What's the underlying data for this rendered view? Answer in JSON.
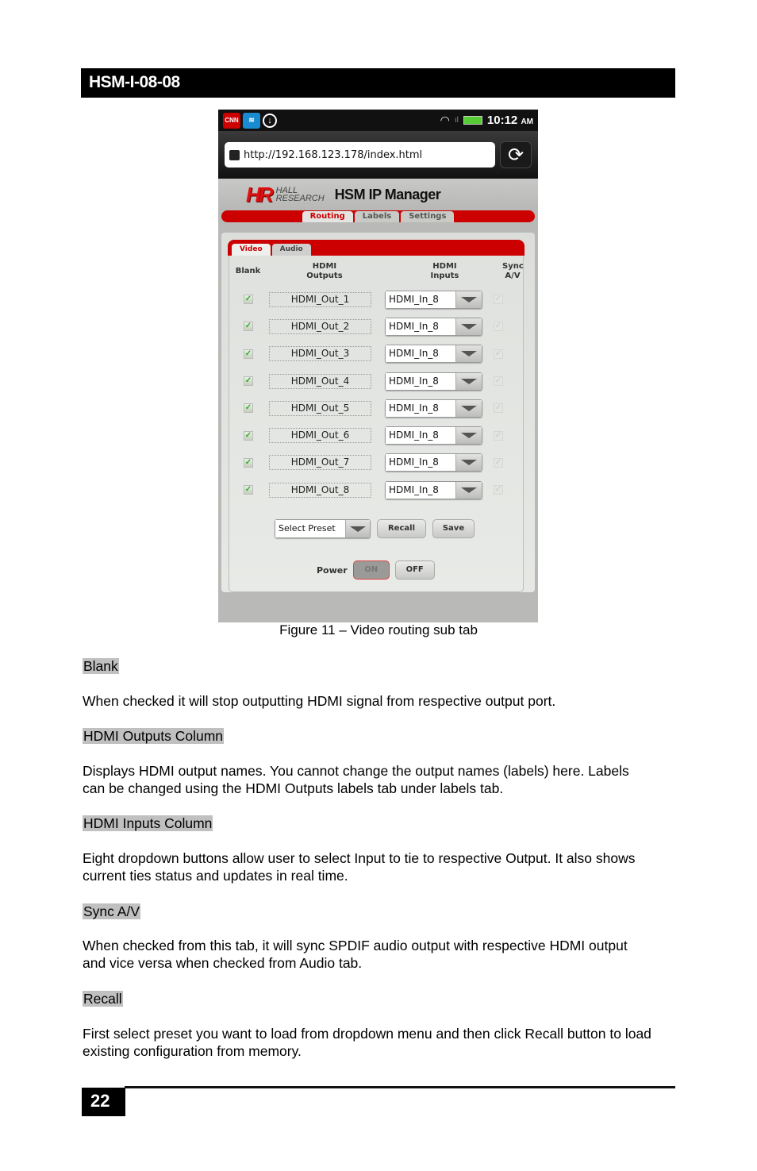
{
  "header": {
    "title": "HSM-I-08-08"
  },
  "phone": {
    "status_bar": {
      "icons": [
        "cnn-icon",
        "wireless-app-icon",
        "download-icon",
        "wifi-icon",
        "signal-icon",
        "battery-icon"
      ],
      "cnn_label": "CNN",
      "time": "10:12",
      "ampm": "AM"
    },
    "browser": {
      "url": "http://192.168.123.178/index.html"
    },
    "app": {
      "brand_logo": "HR",
      "brand_name_line1": "HALL",
      "brand_name_line2": "RESEARCH",
      "title": "HSM IP Manager",
      "main_tabs": [
        {
          "label": "Routing",
          "active": true
        },
        {
          "label": "Labels",
          "active": false
        },
        {
          "label": "Settings",
          "active": false
        }
      ],
      "sub_tabs": [
        {
          "label": "Video",
          "active": true
        },
        {
          "label": "Audio",
          "active": false
        }
      ],
      "columns": {
        "blank": "Blank",
        "outputs_l1": "HDMI",
        "outputs_l2": "Outputs",
        "inputs_l1": "HDMI",
        "inputs_l2": "Inputs",
        "sync_l1": "Sync",
        "sync_l2": "A/V"
      },
      "rows": [
        {
          "blank": true,
          "output": "HDMI_Out_1",
          "input": "HDMI_In_8",
          "sync": false
        },
        {
          "blank": true,
          "output": "HDMI_Out_2",
          "input": "HDMI_In_8",
          "sync": false
        },
        {
          "blank": true,
          "output": "HDMI_Out_3",
          "input": "HDMI_In_8",
          "sync": false
        },
        {
          "blank": true,
          "output": "HDMI_Out_4",
          "input": "HDMI_In_8",
          "sync": false
        },
        {
          "blank": true,
          "output": "HDMI_Out_5",
          "input": "HDMI_In_8",
          "sync": false
        },
        {
          "blank": true,
          "output": "HDMI_Out_6",
          "input": "HDMI_In_8",
          "sync": false
        },
        {
          "blank": true,
          "output": "HDMI_Out_7",
          "input": "HDMI_In_8",
          "sync": false
        },
        {
          "blank": true,
          "output": "HDMI_Out_8",
          "input": "HDMI_In_8",
          "sync": false
        }
      ],
      "preset": {
        "placeholder": "Select Preset",
        "recall_label": "Recall",
        "save_label": "Save"
      },
      "power": {
        "label": "Power",
        "on_label": "ON",
        "off_label": "OFF",
        "state": "ON"
      }
    }
  },
  "caption": "Figure 11 – Video routing sub tab",
  "sections": [
    {
      "heading": "Blank",
      "body": "When checked it will stop outputting HDMI signal from respective output port."
    },
    {
      "heading": "HDMI Outputs Column",
      "body": "Displays HDMI output names. You cannot change the output names (labels) here. Labels can be changed using the HDMI Outputs labels tab under labels tab."
    },
    {
      "heading": "HDMI Inputs Column",
      "body": "Eight dropdown buttons allow user to select Input to tie to respective Output. It also shows current ties status and updates in real time."
    },
    {
      "heading": "Sync A/V",
      "body": "When checked from this tab, it will sync SPDIF audio output with respective HDMI output and vice versa when checked from Audio tab."
    },
    {
      "heading": "Recall",
      "body": "First select preset you want to load from dropdown menu and then click Recall button to load existing configuration from memory."
    }
  ],
  "footer": {
    "page_number": "22"
  },
  "colors": {
    "accent_red": "#cc0000",
    "highlight": "#c0c0c0"
  }
}
